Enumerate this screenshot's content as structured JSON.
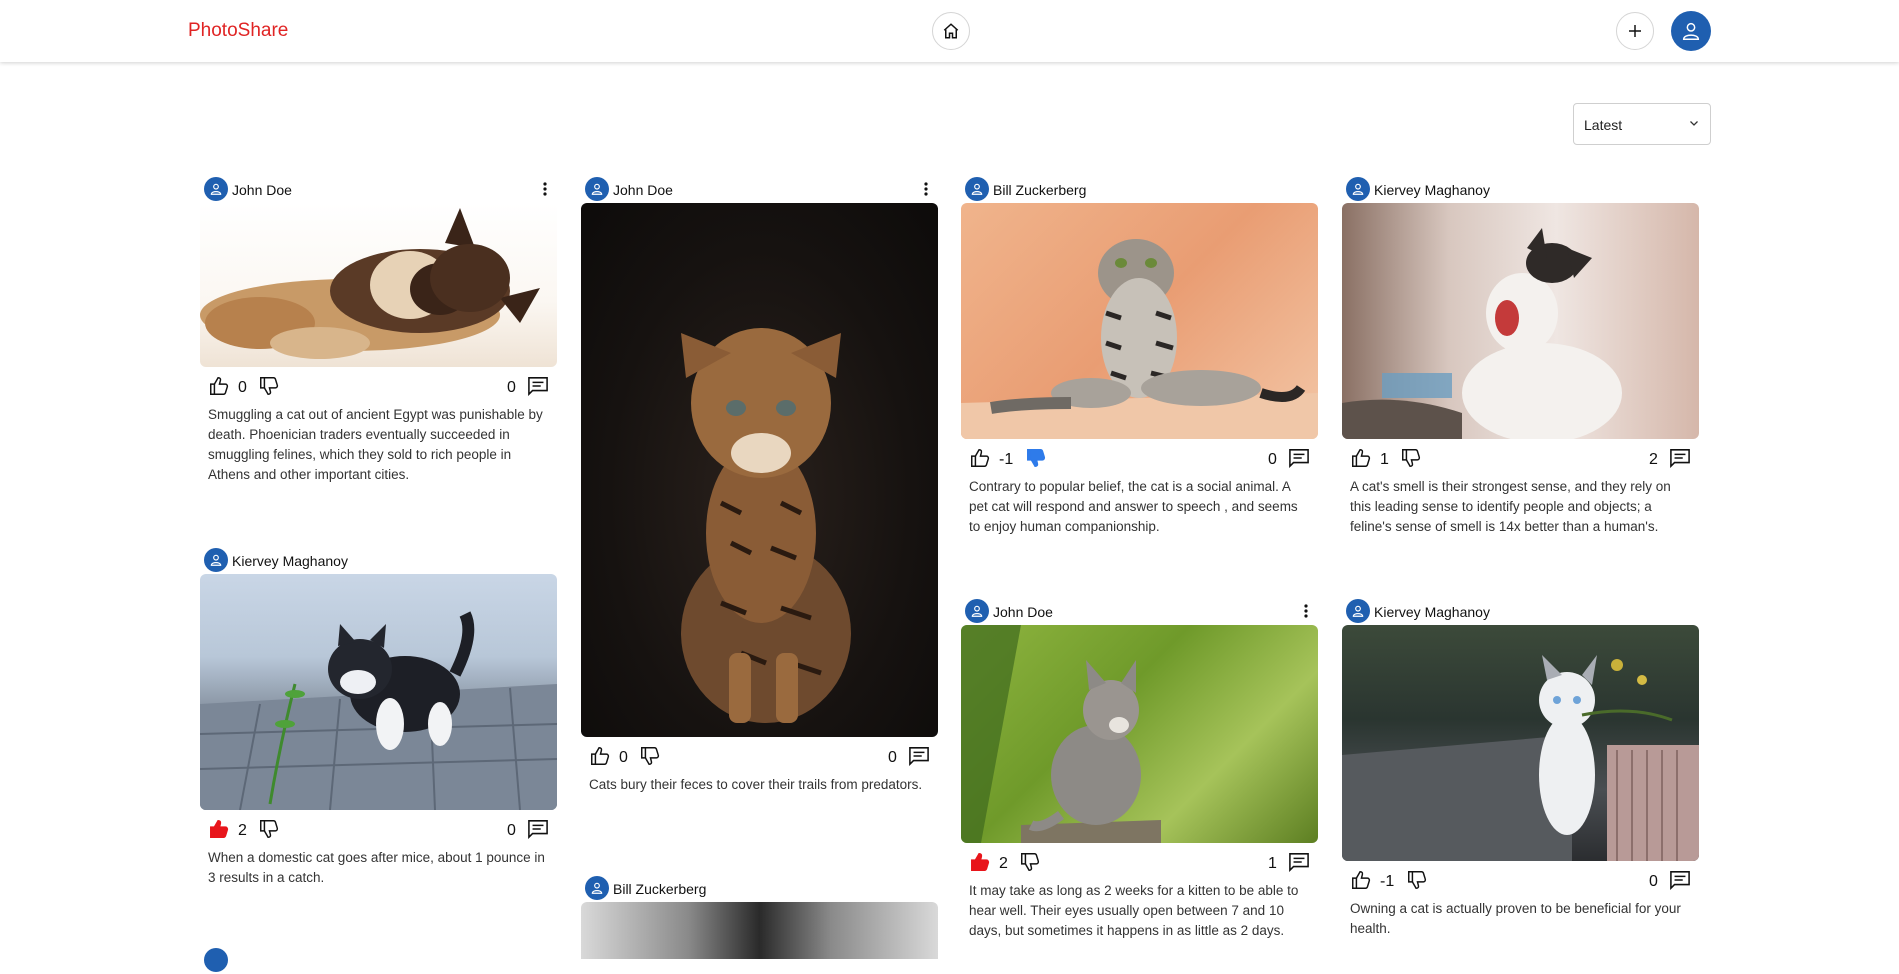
{
  "header": {
    "brand": "PhotoShare",
    "home_icon": "home-icon",
    "add_icon": "plus-icon",
    "profile_icon": "user-icon"
  },
  "sort": {
    "selected": "Latest",
    "chevron": "chevron-down-icon"
  },
  "colors": {
    "brand": "#e02424",
    "accent": "#1f5fb0",
    "liked": "#e8151b",
    "disliked": "#2e7bea"
  },
  "posts": [
    {
      "author": "John Doe",
      "has_menu": true,
      "likes": "0",
      "comments": "0",
      "liked": false,
      "disliked": false,
      "caption": "Smuggling a cat out of ancient Egypt was punishable by death. Phoenician traders eventually succeeded in smuggling felines, which they sold to rich people in Athens and other important cities."
    },
    {
      "author": "Kiervey Maghanoy",
      "has_menu": false,
      "likes": "2",
      "comments": "0",
      "liked": true,
      "disliked": false,
      "caption": "When a domestic cat goes after mice, about 1 pounce in 3 results in a catch."
    },
    {
      "author": "John Doe",
      "has_menu": true,
      "likes": "0",
      "comments": "0",
      "liked": false,
      "disliked": false,
      "caption": "Cats bury their feces to cover their trails from predators."
    },
    {
      "author": "Bill Zuckerberg",
      "has_menu": false
    },
    {
      "author": "Bill Zuckerberg",
      "has_menu": false,
      "likes": "-1",
      "comments": "0",
      "liked": false,
      "disliked": true,
      "caption": "Contrary to popular belief, the cat is a social animal. A pet cat will respond and answer to speech , and seems to enjoy human companionship."
    },
    {
      "author": "John Doe",
      "has_menu": true,
      "likes": "2",
      "comments": "1",
      "liked": true,
      "disliked": false,
      "caption": "It may take as long as 2 weeks for a kitten to be able to hear well. Their eyes usually open between 7 and 10 days, but sometimes it happens in as little as 2 days."
    },
    {
      "author": "Kiervey Maghanoy",
      "has_menu": false,
      "likes": "1",
      "comments": "2",
      "liked": false,
      "disliked": false,
      "caption": "A cat's smell is their strongest sense, and they rely on this leading sense to identify people and objects; a feline's sense of smell is 14x better than a human's."
    },
    {
      "author": "Kiervey Maghanoy",
      "has_menu": false,
      "likes": "-1",
      "comments": "0",
      "liked": false,
      "disliked": false,
      "caption": "Owning a cat is actually proven to be beneficial for your health."
    }
  ]
}
